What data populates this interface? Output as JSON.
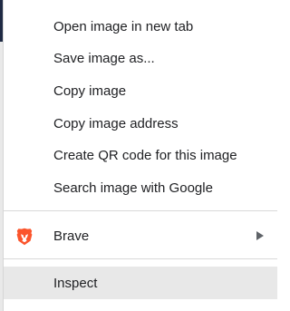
{
  "context_menu": {
    "items": [
      {
        "label": "Open image in new tab"
      },
      {
        "label": "Save image as..."
      },
      {
        "label": "Copy image"
      },
      {
        "label": "Copy image address"
      },
      {
        "label": "Create QR code for this image"
      },
      {
        "label": "Search image with Google"
      }
    ],
    "brave": {
      "label": "Brave",
      "icon": "brave-lion-icon",
      "submenu_icon": "chevron-right-icon"
    },
    "inspect": {
      "label": "Inspect"
    }
  },
  "colors": {
    "menu_background": "#ffffff",
    "hover_background": "#e8e8e8",
    "separator": "#d9d9d9",
    "text": "#202124",
    "brave_brand": "#fb542b"
  }
}
